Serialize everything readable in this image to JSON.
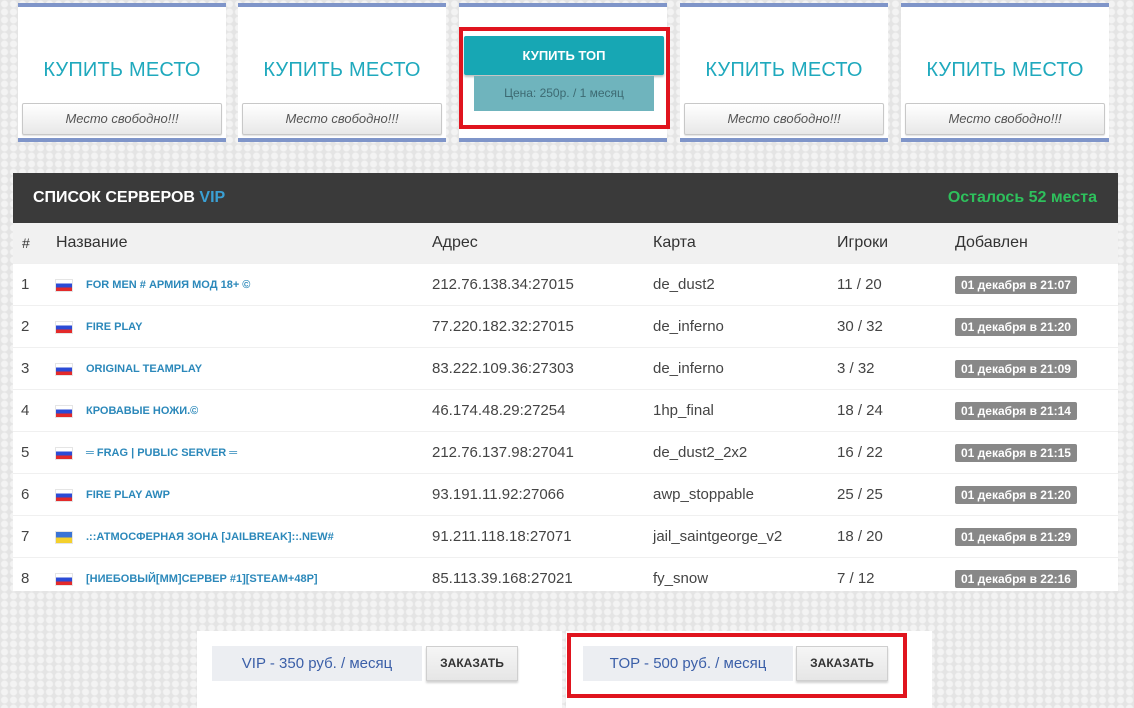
{
  "slots": [
    {
      "title": "КУПИТЬ МЕСТО",
      "status": "Место свободно!!!"
    },
    {
      "title": "КУПИТЬ МЕСТО",
      "status": "Место свободно!!!"
    },
    {
      "title": "КУПИТЬ МЕСТО",
      "status": "Место свободно!!!"
    },
    {
      "title": "КУПИТЬ МЕСТО",
      "status": "Место свободно!!!"
    }
  ],
  "top_slot": {
    "button": "КУПИТЬ ТОП",
    "price": "Цена: 250р. / 1 месяц"
  },
  "vip_list": {
    "title": "СПИСОК СЕРВЕРОВ",
    "title_accent": "VIP",
    "remaining": "Осталось 52 места",
    "columns": [
      "#",
      "Название",
      "Адрес",
      "Карта",
      "Игроки",
      "Добавлен"
    ],
    "rows": [
      {
        "num": "1",
        "flag": "ru-flag-icon",
        "name": "FOR MEN # АРМИЯ МОД 18+ ©",
        "address": "212.76.138.34:27015",
        "map": "de_dust2",
        "players": "11 / 20",
        "added": "01 декабря в 21:07"
      },
      {
        "num": "2",
        "flag": "ru-flag-icon",
        "name": "FIRE PLAY",
        "address": "77.220.182.32:27015",
        "map": "de_inferno",
        "players": "30 / 32",
        "added": "01 декабря в 21:20"
      },
      {
        "num": "3",
        "flag": "ru-flag-icon",
        "name": "ORIGINAL TEAMPLAY",
        "address": "83.222.109.36:27303",
        "map": "de_inferno",
        "players": "3 / 32",
        "added": "01 декабря в 21:09"
      },
      {
        "num": "4",
        "flag": "ru-flag-icon",
        "name": "КРОВАВЫЕ НОЖИ.©",
        "address": "46.174.48.29:27254",
        "map": "1hp_final",
        "players": "18 / 24",
        "added": "01 декабря в 21:14"
      },
      {
        "num": "5",
        "flag": "ru-flag-icon",
        "name": "═ FRAG | PUBLIC SERVER ═",
        "address": "212.76.137.98:27041",
        "map": "de_dust2_2x2",
        "players": "16 / 22",
        "added": "01 декабря в 21:15"
      },
      {
        "num": "6",
        "flag": "ru-flag-icon",
        "name": "FIRE PLAY AWP",
        "address": "93.191.11.92:27066",
        "map": "awp_stoppable",
        "players": "25 / 25",
        "added": "01 декабря в 21:20"
      },
      {
        "num": "7",
        "flag": "ua-flag-icon",
        "name": ".::АТМОСФЕРНАЯ ЗОНА [JAILBREAK]::.NEW#",
        "address": "91.211.118.18:27071",
        "map": "jail_saintgeorge_v2",
        "players": "18 / 20",
        "added": "01 декабря в 21:29"
      },
      {
        "num": "8",
        "flag": "ru-flag-icon",
        "name": "[НИЕБОВЫЙ[ММ]СЕРВЕР #1][STEAM+48P]",
        "address": "85.113.39.168:27021",
        "map": "fy_snow",
        "players": "7 / 12",
        "added": "01 декабря в 22:16"
      }
    ]
  },
  "orders": [
    {
      "label": "VIP - 350 руб. / месяц",
      "button": "ЗАКАЗАТЬ"
    },
    {
      "label": "TOP - 500 руб. / месяц",
      "button": "ЗАКАЗАТЬ"
    }
  ],
  "colors": {
    "accent": "#17a7b4",
    "highlight": "#e0141e",
    "remaining": "#2ec05c",
    "vip": "#3aa0d4"
  }
}
